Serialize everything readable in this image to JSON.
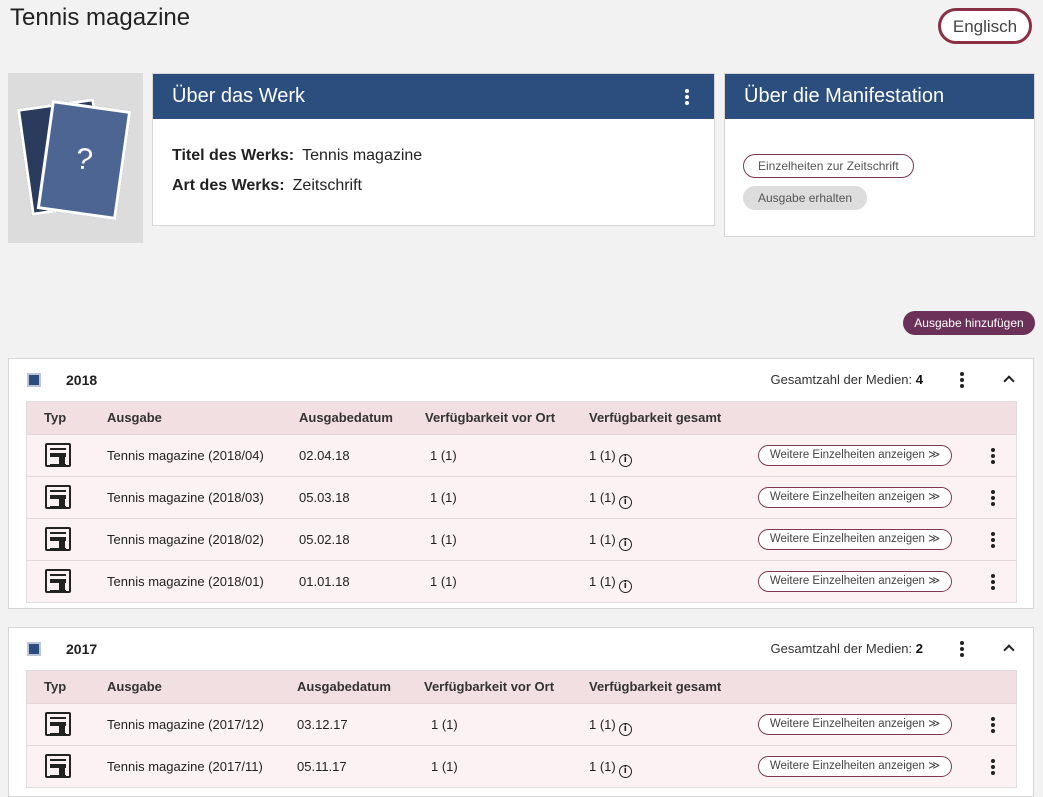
{
  "page": {
    "title": "Tennis magazine",
    "language": "Englisch"
  },
  "work": {
    "header": "Über das Werk",
    "title_label": "Titel des Werks:",
    "title_value": "Tennis magazine",
    "type_label": "Art des Werks:",
    "type_value": "Zeitschrift"
  },
  "manifestation": {
    "header": "Über die Manifestation",
    "details_label": "Einzelheiten zur Zeitschrift",
    "receive_label": "Ausgabe erhalten"
  },
  "cover": {
    "placeholder": "?"
  },
  "add_issue_label": "Ausgabe hinzufügen",
  "columns": {
    "type": "Typ",
    "issue": "Ausgabe",
    "date": "Ausgabedatum",
    "local": "Verfügbarkeit vor Ort",
    "total": "Verfügbarkeit gesamt"
  },
  "total_label": "Gesamtzahl der Medien:",
  "details_button": "Weitere Einzelheiten anzeigen ≫",
  "info_glyph": "i",
  "years": [
    {
      "year": "2018",
      "total": "4",
      "rows": [
        {
          "issue": "Tennis magazine (2018/04)",
          "date": "02.04.18",
          "local": "1 (1)",
          "total": "1 (1)"
        },
        {
          "issue": "Tennis magazine (2018/03)",
          "date": "05.03.18",
          "local": "1 (1)",
          "total": "1 (1)"
        },
        {
          "issue": "Tennis magazine (2018/02)",
          "date": "05.02.18",
          "local": "1 (1)",
          "total": "1 (1)"
        },
        {
          "issue": "Tennis magazine (2018/01)",
          "date": "01.01.18",
          "local": "1 (1)",
          "total": "1 (1)"
        }
      ]
    },
    {
      "year": "2017",
      "total": "2",
      "rows": [
        {
          "issue": "Tennis magazine (2017/12)",
          "date": "03.12.17",
          "local": "1 (1)",
          "total": "1 (1)"
        },
        {
          "issue": "Tennis magazine (2017/11)",
          "date": "05.11.17",
          "local": "1 (1)",
          "total": "1 (1)"
        }
      ]
    }
  ],
  "colors": {
    "header_blue": "#2b4e7e",
    "accent_purple": "#6b3159",
    "row_pink": "#fdf2f3"
  }
}
